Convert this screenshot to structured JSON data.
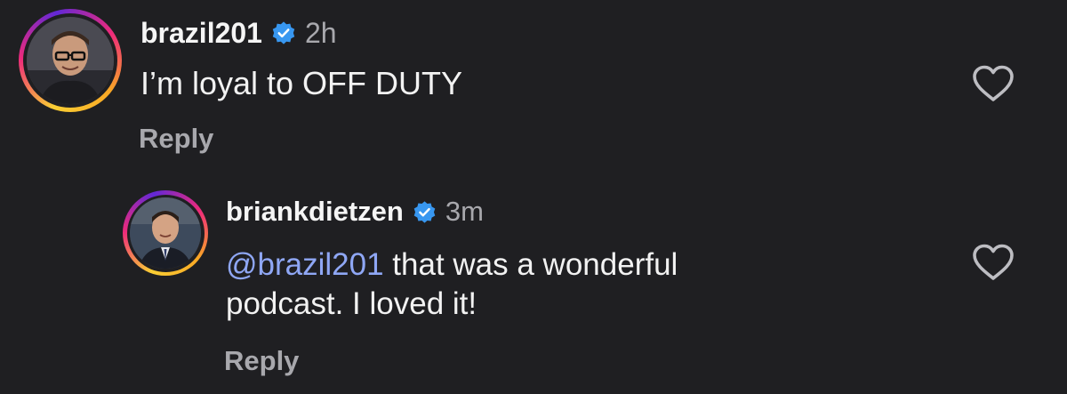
{
  "comments": [
    {
      "username": "brazil201",
      "verified": true,
      "time": "2h",
      "text": "I’m loyal to OFF DUTY",
      "reply_label": "Reply",
      "like_icon": "heart-outline-icon"
    },
    {
      "username": "briankdietzen",
      "verified": true,
      "time": "3m",
      "mention": "@brazil201",
      "text_line1": " that was a wonderful",
      "text_line2": "podcast. I loved it!",
      "reply_label": "Reply",
      "like_icon": "heart-outline-icon"
    }
  ],
  "colors": {
    "background": "#1f1f22",
    "verified_badge": "#3897f0",
    "mention": "#8fa7f5",
    "secondary_text": "#a8a8ad"
  }
}
